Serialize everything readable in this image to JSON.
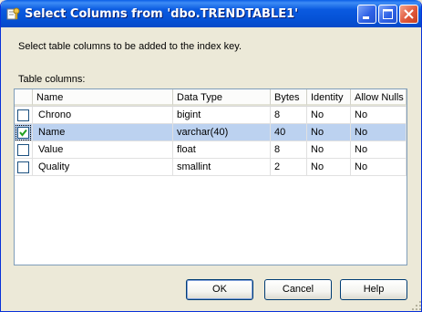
{
  "window": {
    "title": "Select Columns from 'dbo.TRENDTABLE1'"
  },
  "dialog": {
    "instruction": "Select table columns to be added to the index key.",
    "grid_label": "Table columns:"
  },
  "table": {
    "headers": {
      "name": "Name",
      "data_type": "Data Type",
      "bytes": "Bytes",
      "identity": "Identity",
      "allow_nulls": "Allow Nulls"
    },
    "rows": [
      {
        "checked": false,
        "name": "Chrono",
        "data_type": "bigint",
        "bytes": "8",
        "identity": "No",
        "allow_nulls": "No"
      },
      {
        "checked": true,
        "name": "Name",
        "data_type": "varchar(40)",
        "bytes": "40",
        "identity": "No",
        "allow_nulls": "No"
      },
      {
        "checked": false,
        "name": "Value",
        "data_type": "float",
        "bytes": "8",
        "identity": "No",
        "allow_nulls": "No"
      },
      {
        "checked": false,
        "name": "Quality",
        "data_type": "smallint",
        "bytes": "2",
        "identity": "No",
        "allow_nulls": "No"
      }
    ],
    "selected_row": 1
  },
  "buttons": {
    "ok": "OK",
    "cancel": "Cancel",
    "help": "Help"
  },
  "colors": {
    "titlebar": "#0A5AE0",
    "selection": "#BCD2F0",
    "dialog_bg": "#ECE9D8",
    "check_mark": "#21A121"
  }
}
